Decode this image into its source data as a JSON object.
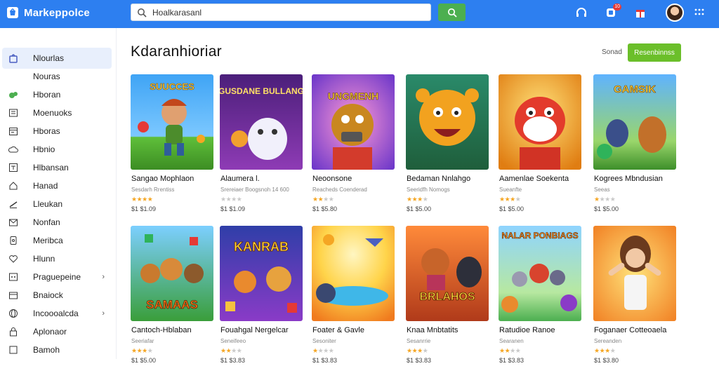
{
  "app": {
    "name": "Markeppolce",
    "colors": {
      "topbar": "#2d7ff0",
      "accent": "#6bbf2a",
      "search_button": "#4caf50",
      "star": "#f5a623"
    }
  },
  "search": {
    "value": "Hoalkarasanl",
    "button_icon": "search-icon"
  },
  "topbar_icons": [
    {
      "name": "headphones-icon"
    },
    {
      "name": "notifications-icon",
      "badge": "10"
    },
    {
      "name": "gift-icon"
    },
    {
      "name": "apps-grid-icon"
    }
  ],
  "sidebar": {
    "items": [
      {
        "label": "Nlourlas",
        "icon": "store-icon",
        "active": true
      },
      {
        "label": "Nouras",
        "icon": "none"
      },
      {
        "label": "Hboran",
        "icon": "gamepad-icon"
      },
      {
        "label": "Moenuoks",
        "icon": "list-icon"
      },
      {
        "label": "Hboras",
        "icon": "calendar-icon"
      },
      {
        "label": "Hbnio",
        "icon": "cloud-icon"
      },
      {
        "label": "Hlbansan",
        "icon": "box-icon"
      },
      {
        "label": "Hanad",
        "icon": "home-icon"
      },
      {
        "label": "Lleukan",
        "icon": "pen-icon"
      },
      {
        "label": "Nonfan",
        "icon": "mail-icon"
      },
      {
        "label": "Meribca",
        "icon": "tablet-icon"
      },
      {
        "label": "Hlunn",
        "icon": "heart-icon"
      },
      {
        "label": "Praguepeine",
        "icon": "grid-icon",
        "chevron": "›"
      },
      {
        "label": "Bnaiock",
        "icon": "folder-icon"
      },
      {
        "label": "Incoooalcda",
        "icon": "globe-icon",
        "chevron": "›"
      },
      {
        "label": "Aplonaor",
        "icon": "lock-icon"
      },
      {
        "label": "Bamoh",
        "icon": "shield-icon"
      }
    ]
  },
  "main": {
    "title": "Kdaranhioriar",
    "sort_label": "Sonad",
    "action_button": "Resenbinnss"
  },
  "games": [
    {
      "name": "Sangao Mophlaon",
      "sub": "Sesdarh Rrentiss",
      "rating": 4,
      "price": "$1 $1.09",
      "thumb_text": "SUUCCES"
    },
    {
      "name": "Alaumera l.",
      "sub": "Srereiaer Boogsnoh 14 600",
      "rating": 0,
      "price": "$1 $1.09",
      "thumb_text": "GUSDANE BULLANG"
    },
    {
      "name": "Neoonsone",
      "sub": "Reacheds Coenderad",
      "rating": 2,
      "price": "$1 $5.80",
      "thumb_text": "UNGMENH"
    },
    {
      "name": "Bedaman Nnlahgo",
      "sub": "Seeridfh Nomogs",
      "rating": 3,
      "price": "$1 $5.00",
      "thumb_text": ""
    },
    {
      "name": "Aamenlae Soekenta",
      "sub": "Sueanfte",
      "rating": 3,
      "price": "$1 $5.00",
      "thumb_text": ""
    },
    {
      "name": "Kogrees Mbndusian",
      "sub": "Seeas",
      "rating": 1,
      "price": "$1 $5.00",
      "thumb_text": "GAMSIK"
    },
    {
      "name": "Cantoch-Hblaban",
      "sub": "Seeriafar",
      "rating": 3,
      "price": "$1 $5.00",
      "thumb_text": "SAMAAS"
    },
    {
      "name": "Fouahgal Nergelcar",
      "sub": "Seneifeeo",
      "rating": 2,
      "price": "$1 $3.83",
      "thumb_text": "KANRAB"
    },
    {
      "name": "Foater & Gavle",
      "sub": "Sesoniter",
      "rating": 1,
      "price": "$1 $3.83",
      "thumb_text": ""
    },
    {
      "name": "Knaa Mnbtatits",
      "sub": "Sesanrrie",
      "rating": 3,
      "price": "$1 $3.83",
      "thumb_text": "BRLAHOS"
    },
    {
      "name": "Ratudioe Ranoe",
      "sub": "Searanen",
      "rating": 2,
      "price": "$1 $3.83",
      "thumb_text": "NALAR PONBIAGS"
    },
    {
      "name": "Foganaer Cotteoaela",
      "sub": "Sereanden",
      "rating": 3,
      "price": "$1 $3.80",
      "thumb_text": ""
    }
  ]
}
